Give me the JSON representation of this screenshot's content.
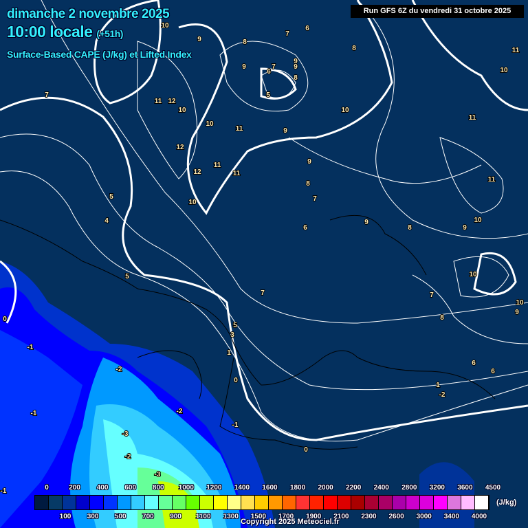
{
  "header": {
    "date": "dimanche 2 novembre 2025",
    "time": "10:00 locale",
    "lead": "(+51h)",
    "product": "Surface-Based CAPE (J/kg) et Lifted Index",
    "run": "Run GFS 6Z du vendredi 31 octobre 2025"
  },
  "legend": {
    "unit": "(J/kg)",
    "top_labels": [
      "0",
      "200",
      "400",
      "600",
      "800",
      "1000",
      "1200",
      "1400",
      "1600",
      "1800",
      "2000",
      "2200",
      "2400",
      "2800",
      "3200",
      "3600",
      "4500"
    ],
    "bottom_labels": [
      "100",
      "300",
      "500",
      "700",
      "900",
      "1100",
      "1300",
      "1500",
      "1700",
      "1900",
      "2100",
      "2300",
      "2600",
      "3000",
      "3400",
      "4000"
    ],
    "colors": [
      "#001a40",
      "#063a66",
      "#003399",
      "#0000cc",
      "#0000ff",
      "#0033ff",
      "#0099ff",
      "#33ccff",
      "#66ffff",
      "#66ff99",
      "#66ff66",
      "#66ff00",
      "#ccff00",
      "#ffff00",
      "#ffff88",
      "#ffe050",
      "#ffcc00",
      "#ff9900",
      "#ff6600",
      "#ff3333",
      "#ff2200",
      "#ff0000",
      "#dd0000",
      "#aa0000",
      "#aa0033",
      "#aa0066",
      "#aa00aa",
      "#cc00cc",
      "#dd00dd",
      "#ff00ff",
      "#dd77dd",
      "#ffbbff",
      "#ffffff"
    ]
  },
  "contour_labels": [
    "10",
    "9",
    "9",
    "9",
    "8",
    "7",
    "6",
    "8",
    "11",
    "10",
    "9",
    "8",
    "6",
    "7",
    "5",
    "10",
    "11",
    "12",
    "10",
    "11",
    "9",
    "7",
    "10",
    "11",
    "12",
    "11",
    "9",
    "8",
    "7",
    "12",
    "11",
    "10",
    "11",
    "5",
    "4",
    "6",
    "9",
    "8",
    "10",
    "9",
    "5",
    "7",
    "7",
    "10",
    "8",
    "10",
    "9",
    "5",
    "3",
    "1",
    "0",
    "-1",
    "-2",
    "-2",
    "-3",
    "-2",
    "-3",
    "-1",
    "-1",
    "-1",
    "0",
    "0",
    "6",
    "6",
    "1",
    "-2"
  ],
  "copyright": "Copyright 2025 Meteociel.fr"
}
